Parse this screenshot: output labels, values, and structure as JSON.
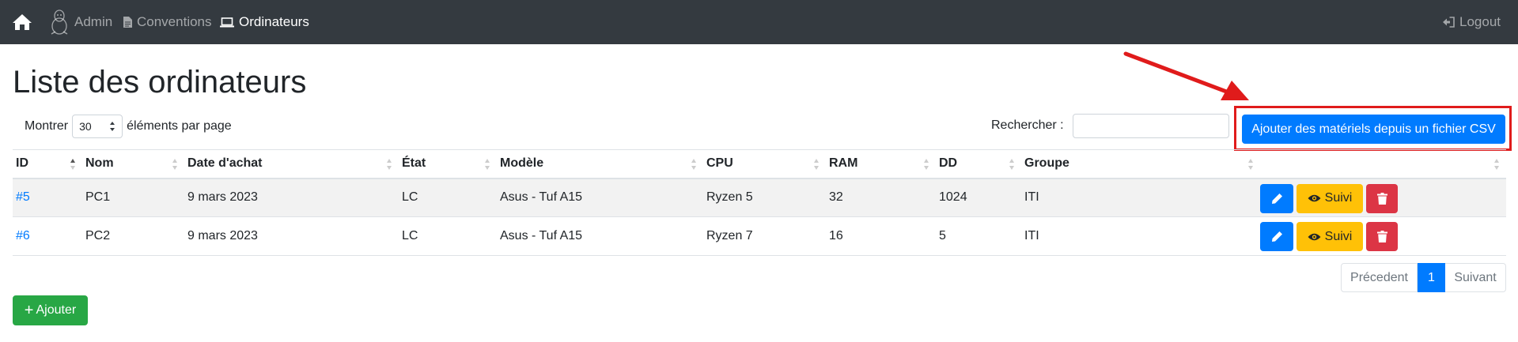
{
  "navbar": {
    "home_icon": "home-icon",
    "links": [
      {
        "label": "Admin",
        "icon": "linux-icon"
      },
      {
        "label": "Conventions",
        "icon": "file-icon"
      },
      {
        "label": "Ordinateurs",
        "icon": "laptop-icon",
        "active": true
      }
    ],
    "logout": {
      "label": "Logout",
      "icon": "logout-icon"
    }
  },
  "page": {
    "title": "Liste des ordinateurs"
  },
  "length_menu": {
    "prefix": "Montrer",
    "value": "30",
    "suffix": "éléments par page"
  },
  "search": {
    "label": "Rechercher :",
    "value": "",
    "placeholder": ""
  },
  "csv_button": {
    "label": "Ajouter des matériels depuis un fichier CSV"
  },
  "annotation": {
    "arrow_color": "#e01b1b",
    "box_color": "#e01b1b"
  },
  "table": {
    "columns": [
      "ID",
      "Nom",
      "Date d'achat",
      "État",
      "Modèle",
      "CPU",
      "RAM",
      "DD",
      "Groupe",
      ""
    ],
    "rows": [
      {
        "id": "#5",
        "nom": "PC1",
        "date": "9 mars 2023",
        "etat": "LC",
        "modele": "Asus - Tuf A15",
        "cpu": "Ryzen 5",
        "ram": "32",
        "dd": "1024",
        "groupe": "ITI"
      },
      {
        "id": "#6",
        "nom": "PC2",
        "date": "9 mars 2023",
        "etat": "LC",
        "modele": "Asus - Tuf A15",
        "cpu": "Ryzen 7",
        "ram": "16",
        "dd": "5",
        "groupe": "ITI"
      }
    ],
    "row_actions": {
      "edit_icon": "pencil-icon",
      "suivi_label": "Suivi",
      "suivi_icon": "eye-icon",
      "delete_icon": "trash-icon"
    }
  },
  "pagination": {
    "previous": "Précedent",
    "current": "1",
    "next": "Suivant"
  },
  "add_button": {
    "label": "Ajouter",
    "icon": "plus-icon"
  },
  "colors": {
    "navbar": "#343a40",
    "primary": "#007bff",
    "warning": "#ffc107",
    "danger": "#dc3545",
    "success": "#28a745"
  }
}
